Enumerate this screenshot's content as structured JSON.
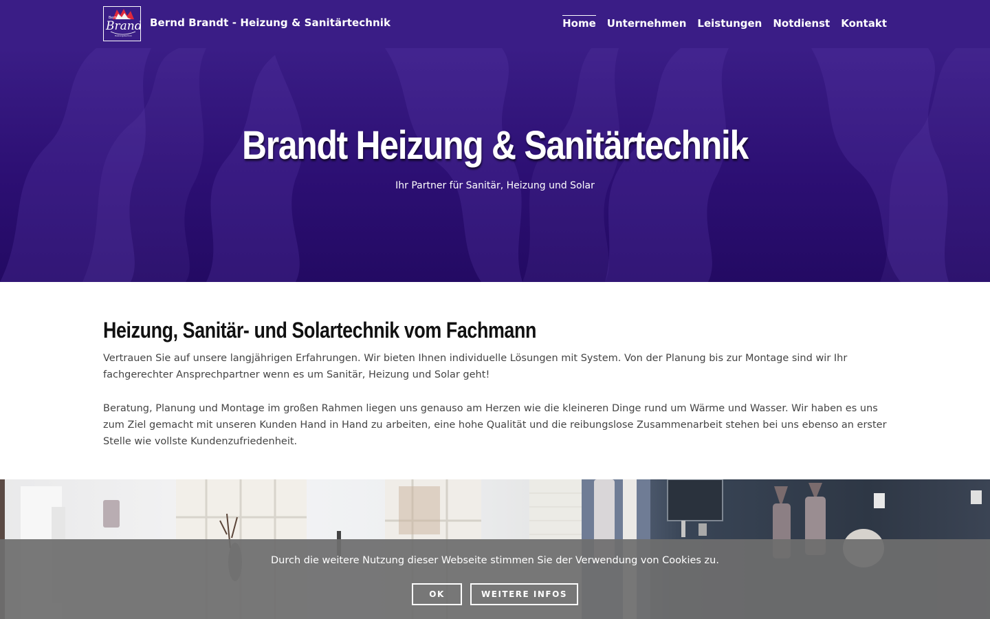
{
  "header": {
    "logo": {
      "script_text": "Brandt",
      "small_text": "Bernd",
      "tagline": "Heizungstechnik"
    },
    "site_title": "Bernd Brandt - Heizung & Sanitärtechnik",
    "nav": [
      {
        "label": "Home",
        "active": true
      },
      {
        "label": "Unternehmen"
      },
      {
        "label": "Leistungen"
      },
      {
        "label": "Notdienst"
      },
      {
        "label": "Kontakt"
      }
    ]
  },
  "hero": {
    "title": "Brandt Heizung & Sanitärtechnik",
    "subtitle": "Ihr Partner für Sanitär, Heizung und Solar"
  },
  "intro": {
    "heading": "Heizung, Sanitär- und Solartechnik vom Fachmann",
    "paragraph1": "Vertrauen Sie auf unsere langjährigen Erfahrungen. Wir bieten Ihnen individuelle Lösungen mit System. Von der Planung bis zur Montage sind wir Ihr fachgerechter Ansprechpartner wenn es um Sanitär, Heizung und Solar geht!",
    "paragraph2": "Beratung, Planung und Montage im großen Rahmen liegen uns genauso am Herzen wie die kleineren Dinge rund um Wärme und Wasser. Wir haben es uns zum Ziel gemacht mit unseren Kunden Hand in Hand zu arbeiten, eine hohe Qualität und die reibungslose Zusammenarbeit stehen bei uns ebenso an erster Stelle wie vollste Kundenzufriedenheit."
  },
  "cookie_banner": {
    "text": "Durch die weitere Nutzung dieser Webseite stimmen Sie der Verwendung von Cookies zu.",
    "ok_label": "OK",
    "info_label": "WEITERE INFOS"
  },
  "colors": {
    "header_bg": "#3a1d86",
    "hero_bg": "#2c0f73",
    "cookie_bg": "#6e6e6e"
  }
}
